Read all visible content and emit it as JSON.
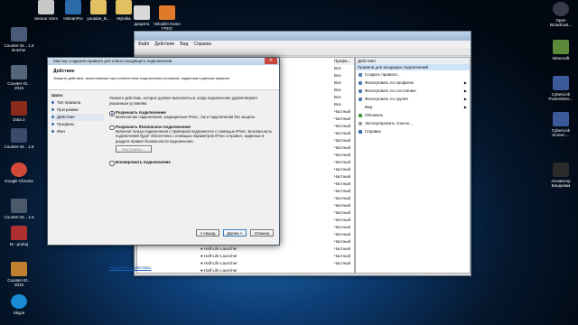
{
  "desktop_icons_left": [
    "Counter-St... 1.6 Butcher",
    "Counter-St... 2015",
    "Dota 2",
    "Counter-St... 1.6",
    "Google Chrome",
    "Counter-St... 1.6",
    "M - proboj",
    "Counter-St... 2015",
    "Skype"
  ],
  "desktop_icons_top": [
    "Sennur Sinm",
    "HitmanPro",
    "youtube_B...",
    "Mylolka",
    "дворята",
    "VeloalDi Home FREE"
  ],
  "desktop_icons_right": [
    "Open Broadcast...",
    "Minecraft",
    "CyberLink PowerDirec...",
    "CyberLink Screen ...",
    "Активатор Бандикам"
  ],
  "main_window": {
    "menu": [
      "Файл",
      "Действие",
      "Вид",
      "Справка"
    ],
    "profile_col_header": "Профи...",
    "profile_values": [
      "Все",
      "Все",
      "Все",
      "Все",
      "Все",
      "Все",
      "Частный",
      "Частный",
      "Частный",
      "Частный",
      "Частный",
      "Частный",
      "Частный",
      "Частный",
      "Частный",
      "Частный",
      "Частный",
      "Частный",
      "Частный",
      "Частный",
      "Частный",
      "Частный",
      "Частный",
      "Частный",
      "Частный",
      "Частный",
      "Частный",
      "Частный"
    ],
    "rule_rows": [
      "Half-Life Launcher",
      "Half-Life Launcher",
      "Half-Life Launcher",
      "Half-Life Launcher",
      "Half-Life Launcher"
    ]
  },
  "actions_pane": {
    "header": "Действия",
    "selected": "Правила для входящих подключений",
    "items": [
      {
        "label": "Создать правило...",
        "arrow": false
      },
      {
        "label": "Фильтровать по профилю",
        "arrow": true
      },
      {
        "label": "Фильтровать по состоянию",
        "arrow": true
      },
      {
        "label": "Фильтровать по группе",
        "arrow": true
      },
      {
        "label": "Вид",
        "arrow": true
      },
      {
        "label": "Обновить",
        "arrow": false
      },
      {
        "label": "Экспортировать список...",
        "arrow": false
      },
      {
        "label": "Справка",
        "arrow": false
      }
    ]
  },
  "dialog": {
    "title": "Мастер создания правила для нового входящего подключения",
    "heading": "Действие",
    "subheading": "Укажите действие, выполняемое при соответствии подключения условиям, заданным в данном правиле.",
    "steps_label": "Шаги:",
    "steps": [
      "Тип правила",
      "Программа",
      "Действие",
      "Профиль",
      "Имя"
    ],
    "current_step": "Действие",
    "question": "Укажите действие, которое должно выполняться, когда подключение удовлетворяет указанным условиям.",
    "options": [
      {
        "label": "Разрешить подключение",
        "desc": "Включая как подключения, защищенные IPSec, так и подключения без защиты.",
        "checked": true
      },
      {
        "label": "Разрешить безопасное подключение",
        "desc": "Включая только подключения с проверкой подлинности с помощью IPSec. Безопасность подключений будет обеспечена с помощью параметров IPSec и правил, заданных в разделе правил безопасности подключения.",
        "checked": false
      },
      {
        "label": "Блокировать подключение",
        "desc": "",
        "checked": false
      }
    ],
    "customize_button": "Настроить...",
    "more_link": "Подробнее о действиях",
    "back_button": "< Назад",
    "next_button": "Далее >",
    "cancel_button": "Отмена"
  }
}
